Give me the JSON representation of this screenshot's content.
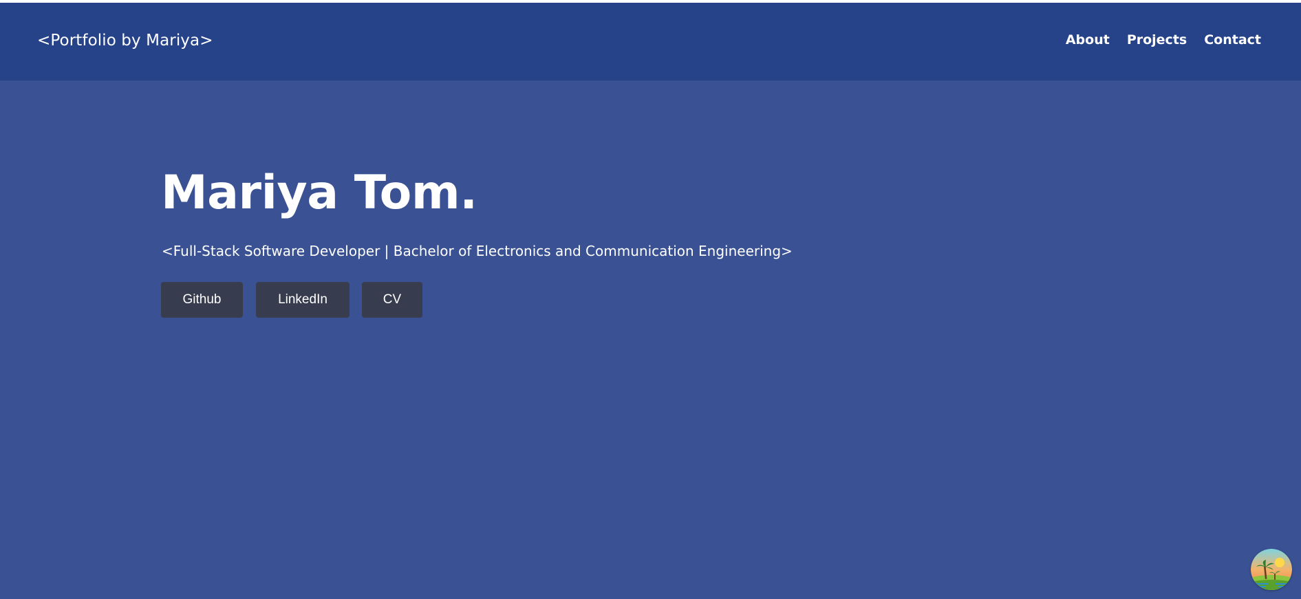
{
  "header": {
    "brand": "<Portfolio by Mariya>",
    "nav": [
      {
        "label": "About"
      },
      {
        "label": "Projects"
      },
      {
        "label": "Contact"
      }
    ]
  },
  "hero": {
    "name": "Mariya Tom.",
    "subtitle": "<Full-Stack Software Developer | Bachelor of Electronics and Communication Engineering>",
    "buttons": [
      {
        "label": "Github"
      },
      {
        "label": "LinkedIn"
      },
      {
        "label": "CV"
      }
    ]
  },
  "widget": {
    "icon": "palm-beach-sunset-icon"
  },
  "colors": {
    "navbar": "#26438a",
    "hero_background": "#3a5294",
    "button_background": "#383c4f",
    "text": "#ffffff"
  }
}
